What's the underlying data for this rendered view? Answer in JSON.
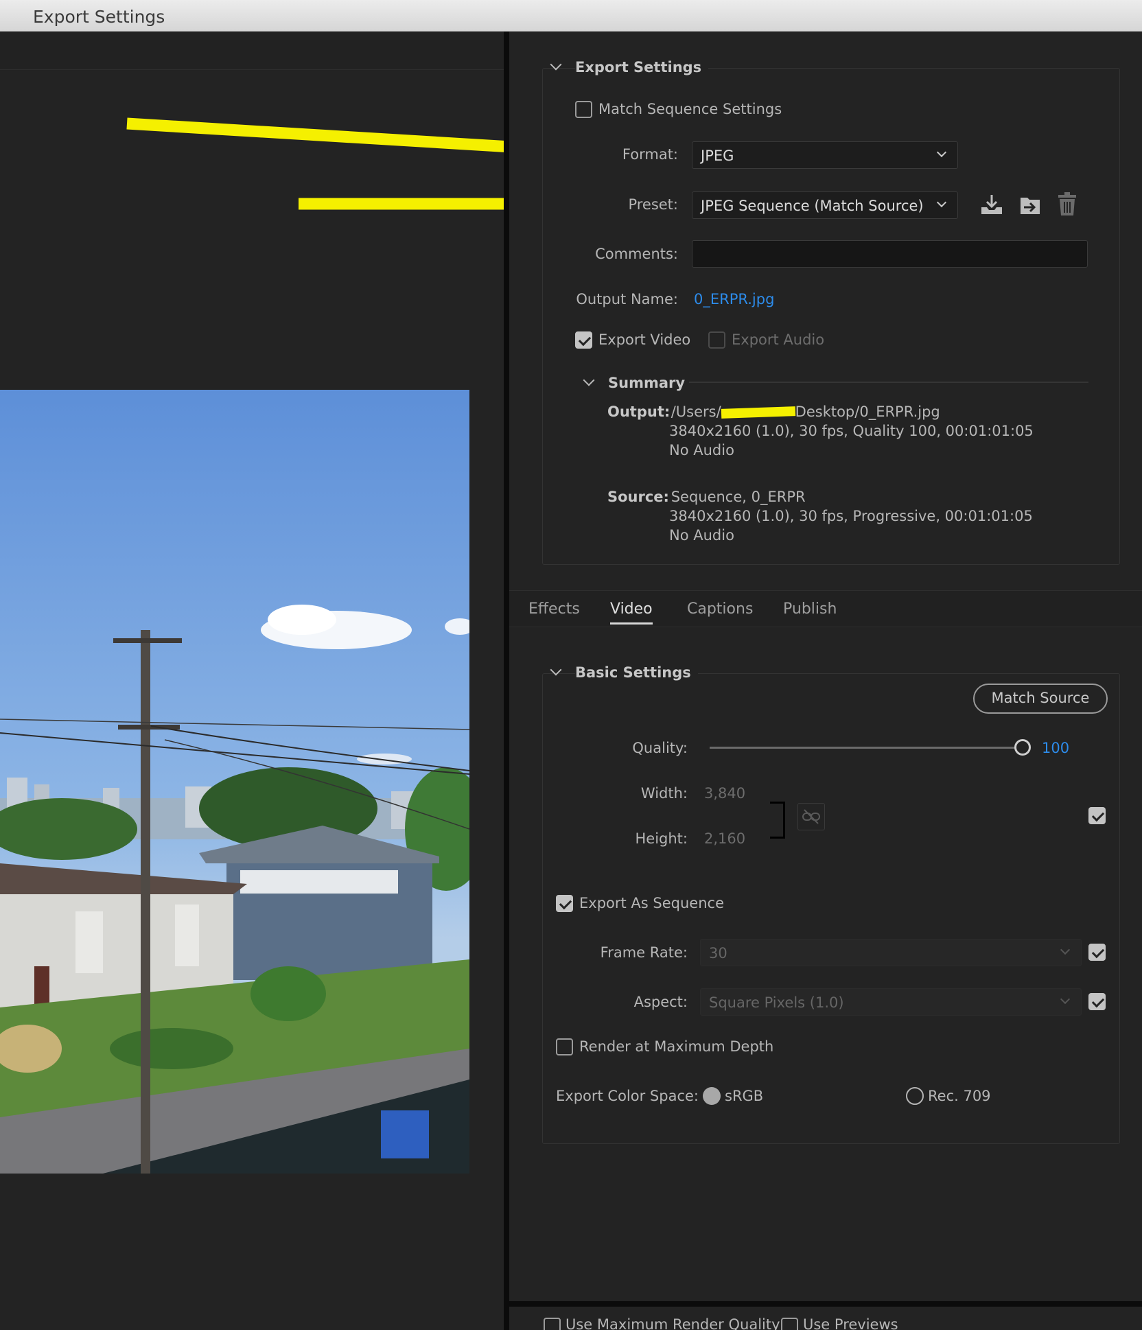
{
  "window": {
    "title": "Export Settings"
  },
  "export_settings": {
    "section_title": "Export Settings",
    "match_sequence_label": "Match Sequence Settings",
    "format_label": "Format:",
    "format_value": "JPEG",
    "preset_label": "Preset:",
    "preset_value": "JPEG Sequence (Match Source)",
    "comments_label": "Comments:",
    "comments_value": "",
    "output_name_label": "Output Name:",
    "output_name_value": "0_ERPR.jpg",
    "export_video_label": "Export Video",
    "export_audio_label": "Export Audio"
  },
  "summary": {
    "title": "Summary",
    "output_label": "Output:",
    "output_path_prefix": "/Users/",
    "output_path_suffix": "Desktop/0_ERPR.jpg",
    "output_line2": "3840x2160 (1.0), 30 fps, Quality 100, 00:01:01:05",
    "output_line3": "No Audio",
    "source_label": "Source:",
    "source_line1": "Sequence, 0_ERPR",
    "source_line2": "3840x2160 (1.0), 30 fps, Progressive, 00:01:01:05",
    "source_line3": "No Audio"
  },
  "tabs": [
    "Effects",
    "Video",
    "Captions",
    "Publish"
  ],
  "basic_settings": {
    "title": "Basic Settings",
    "match_source_button": "Match Source",
    "quality_label": "Quality:",
    "quality_value": "100",
    "quality_fraction": 1.0,
    "width_label": "Width:",
    "width_value": "3,840",
    "height_label": "Height:",
    "height_value": "2,160",
    "export_as_sequence_label": "Export As Sequence",
    "frame_rate_label": "Frame Rate:",
    "frame_rate_value": "30",
    "aspect_label": "Aspect:",
    "aspect_value": "Square Pixels (1.0)",
    "render_max_depth_label": "Render at Maximum Depth",
    "color_space_label": "Export Color Space:",
    "color_space_srgb": "sRGB",
    "color_space_rec709": "Rec. 709"
  },
  "footer": {
    "max_render_label": "Use Maximum Render Quality",
    "use_previews_label": "Use Previews"
  },
  "colors": {
    "accent_link": "#2d8ceb",
    "annotation_arrow": "#f5f000"
  }
}
